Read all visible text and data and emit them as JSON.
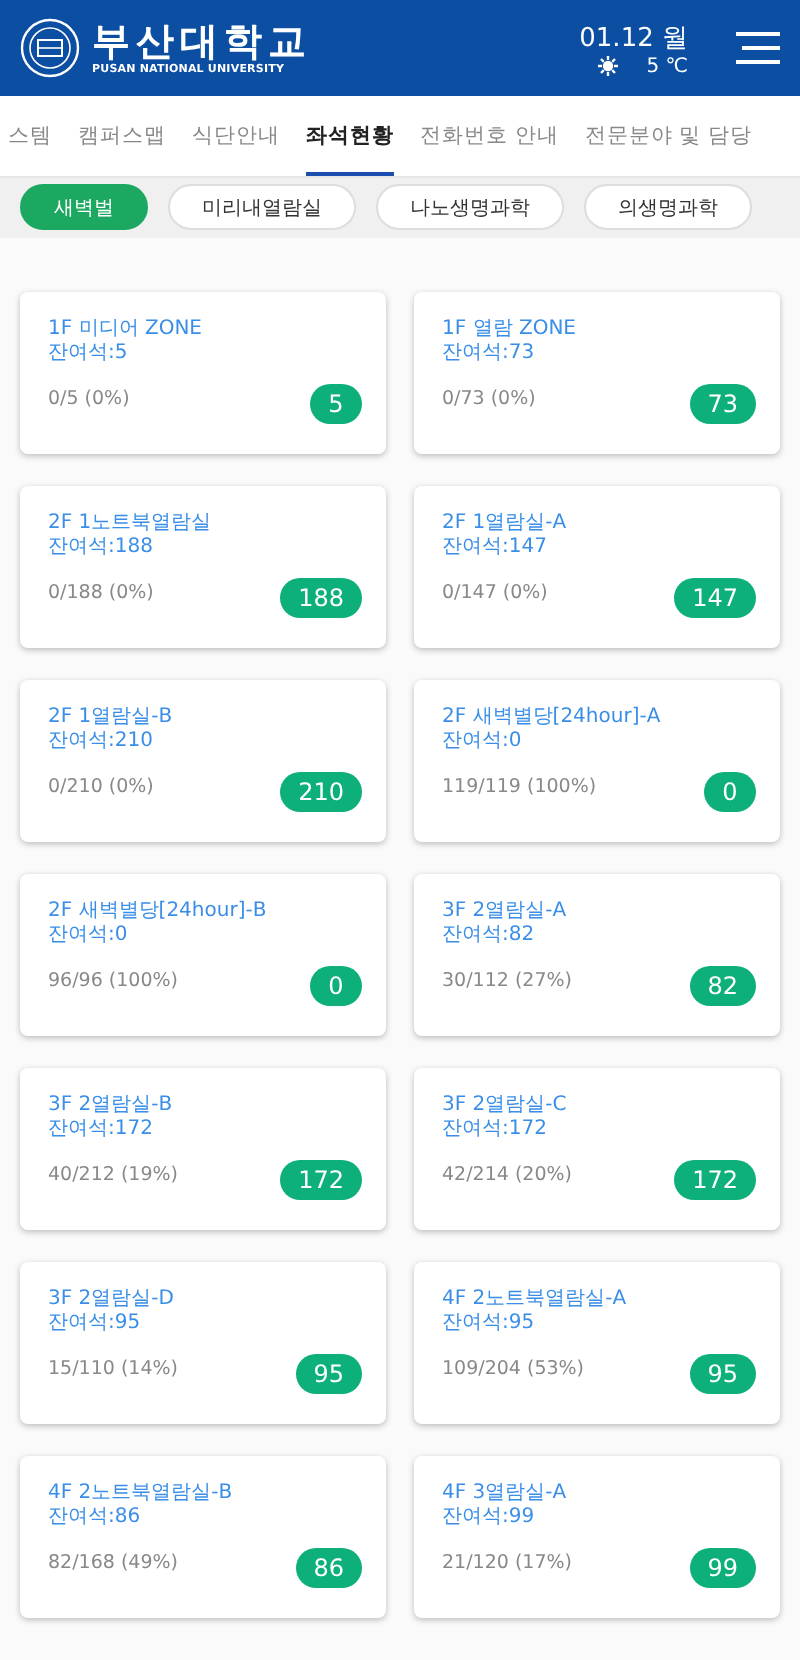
{
  "header": {
    "title": "부산대학교",
    "subtitle": "PUSAN NATIONAL UNIVERSITY",
    "date": "01.12 월",
    "temperature": "5 ℃"
  },
  "tabs": [
    {
      "label": "스템",
      "selected": false
    },
    {
      "label": "캠퍼스맵",
      "selected": false
    },
    {
      "label": "식단안내",
      "selected": false
    },
    {
      "label": "좌석현황",
      "selected": true
    },
    {
      "label": "전화번호 안내",
      "selected": false
    },
    {
      "label": "전문분야 및 담당",
      "selected": false
    }
  ],
  "filters": [
    {
      "label": "새벽벌",
      "selected": true
    },
    {
      "label": "미리내열람실",
      "selected": false
    },
    {
      "label": "나노생명과학",
      "selected": false
    },
    {
      "label": "의생명과학",
      "selected": false
    }
  ],
  "rooms": [
    {
      "name": "1F 미디어 ZONE",
      "remaining": "잔여석:5",
      "usage": "0/5 (0%)",
      "badge": "5"
    },
    {
      "name": "1F 열람 ZONE",
      "remaining": "잔여석:73",
      "usage": "0/73 (0%)",
      "badge": "73"
    },
    {
      "name": "2F 1노트북열람실",
      "remaining": "잔여석:188",
      "usage": "0/188 (0%)",
      "badge": "188"
    },
    {
      "name": "2F 1열람실-A",
      "remaining": "잔여석:147",
      "usage": "0/147 (0%)",
      "badge": "147"
    },
    {
      "name": "2F 1열람실-B",
      "remaining": "잔여석:210",
      "usage": "0/210 (0%)",
      "badge": "210"
    },
    {
      "name": "2F 새벽별당[24hour]-A",
      "remaining": "잔여석:0",
      "usage": "119/119 (100%)",
      "badge": "0"
    },
    {
      "name": "2F 새벽별당[24hour]-B",
      "remaining": "잔여석:0",
      "usage": "96/96 (100%)",
      "badge": "0"
    },
    {
      "name": "3F 2열람실-A",
      "remaining": "잔여석:82",
      "usage": "30/112 (27%)",
      "badge": "82"
    },
    {
      "name": "3F 2열람실-B",
      "remaining": "잔여석:172",
      "usage": "40/212 (19%)",
      "badge": "172"
    },
    {
      "name": "3F 2열람실-C",
      "remaining": "잔여석:172",
      "usage": "42/214 (20%)",
      "badge": "172"
    },
    {
      "name": "3F 2열람실-D",
      "remaining": "잔여석:95",
      "usage": "15/110 (14%)",
      "badge": "95"
    },
    {
      "name": "4F 2노트북열람실-A",
      "remaining": "잔여석:95",
      "usage": "109/204 (53%)",
      "badge": "95"
    },
    {
      "name": "4F 2노트북열람실-B",
      "remaining": "잔여석:86",
      "usage": "82/168 (49%)",
      "badge": "86"
    },
    {
      "name": "4F 3열람실-A",
      "remaining": "잔여석:99",
      "usage": "21/120 (17%)",
      "badge": "99"
    }
  ]
}
